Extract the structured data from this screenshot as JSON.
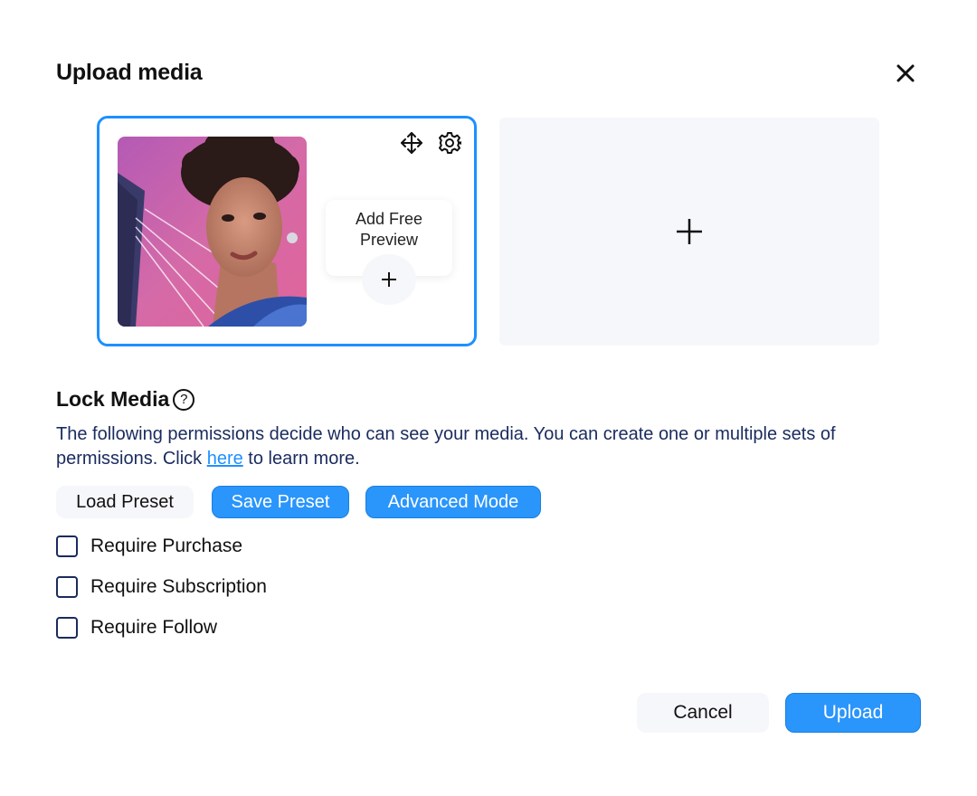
{
  "dialog": {
    "title": "Upload media"
  },
  "media": {
    "free_preview_label": "Add Free Preview"
  },
  "lock_media": {
    "title": "Lock Media",
    "help_glyph": "?",
    "description_before": "The following permissions decide who can see your media. You can create one or multiple sets of permissions. Click ",
    "link_text": "here",
    "description_after": " to learn more.",
    "buttons": {
      "load_preset": "Load Preset",
      "save_preset": "Save Preset",
      "advanced_mode": "Advanced Mode"
    },
    "permissions": [
      {
        "label": "Require Purchase",
        "checked": false
      },
      {
        "label": "Require Subscription",
        "checked": false
      },
      {
        "label": "Require Follow",
        "checked": false
      }
    ]
  },
  "footer": {
    "cancel_label": "Cancel",
    "upload_label": "Upload"
  },
  "colors": {
    "accent": "#1e90ff",
    "button_blue": "#2a95fb",
    "description_text": "#1a2b5e",
    "tile_bg": "#f6f7fb"
  },
  "icons": [
    "close-icon",
    "move-icon",
    "gear-icon",
    "plus-icon",
    "help-icon",
    "edit-pencil-icon"
  ]
}
